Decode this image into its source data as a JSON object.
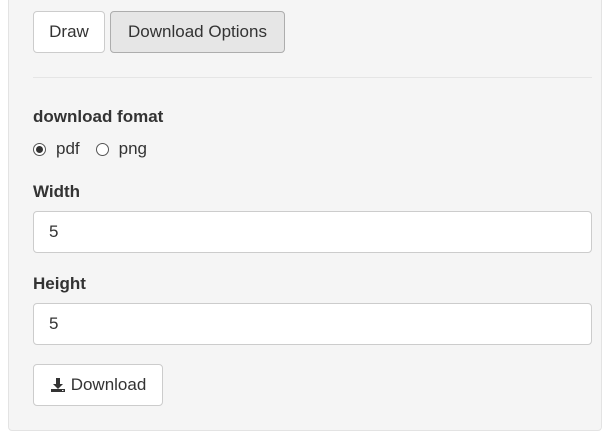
{
  "tabs": {
    "draw_label": "Draw",
    "options_label": "Download Options"
  },
  "download_format": {
    "label": "download fomat",
    "options": [
      {
        "label": "pdf",
        "selected": true
      },
      {
        "label": "png",
        "selected": false
      }
    ]
  },
  "width": {
    "label": "Width",
    "value": "5"
  },
  "height": {
    "label": "Height",
    "value": "5"
  },
  "download_button": {
    "label": "Download",
    "icon": "download-icon"
  }
}
